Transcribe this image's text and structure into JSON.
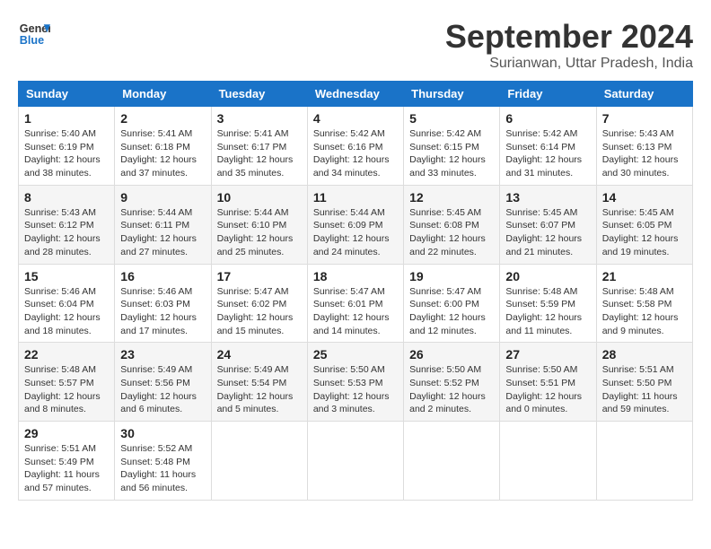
{
  "header": {
    "logo_line1": "General",
    "logo_line2": "Blue",
    "month": "September 2024",
    "location": "Surianwan, Uttar Pradesh, India"
  },
  "weekdays": [
    "Sunday",
    "Monday",
    "Tuesday",
    "Wednesday",
    "Thursday",
    "Friday",
    "Saturday"
  ],
  "weeks": [
    [
      {
        "day": "1",
        "info": "Sunrise: 5:40 AM\nSunset: 6:19 PM\nDaylight: 12 hours\nand 38 minutes."
      },
      {
        "day": "2",
        "info": "Sunrise: 5:41 AM\nSunset: 6:18 PM\nDaylight: 12 hours\nand 37 minutes."
      },
      {
        "day": "3",
        "info": "Sunrise: 5:41 AM\nSunset: 6:17 PM\nDaylight: 12 hours\nand 35 minutes."
      },
      {
        "day": "4",
        "info": "Sunrise: 5:42 AM\nSunset: 6:16 PM\nDaylight: 12 hours\nand 34 minutes."
      },
      {
        "day": "5",
        "info": "Sunrise: 5:42 AM\nSunset: 6:15 PM\nDaylight: 12 hours\nand 33 minutes."
      },
      {
        "day": "6",
        "info": "Sunrise: 5:42 AM\nSunset: 6:14 PM\nDaylight: 12 hours\nand 31 minutes."
      },
      {
        "day": "7",
        "info": "Sunrise: 5:43 AM\nSunset: 6:13 PM\nDaylight: 12 hours\nand 30 minutes."
      }
    ],
    [
      {
        "day": "8",
        "info": "Sunrise: 5:43 AM\nSunset: 6:12 PM\nDaylight: 12 hours\nand 28 minutes."
      },
      {
        "day": "9",
        "info": "Sunrise: 5:44 AM\nSunset: 6:11 PM\nDaylight: 12 hours\nand 27 minutes."
      },
      {
        "day": "10",
        "info": "Sunrise: 5:44 AM\nSunset: 6:10 PM\nDaylight: 12 hours\nand 25 minutes."
      },
      {
        "day": "11",
        "info": "Sunrise: 5:44 AM\nSunset: 6:09 PM\nDaylight: 12 hours\nand 24 minutes."
      },
      {
        "day": "12",
        "info": "Sunrise: 5:45 AM\nSunset: 6:08 PM\nDaylight: 12 hours\nand 22 minutes."
      },
      {
        "day": "13",
        "info": "Sunrise: 5:45 AM\nSunset: 6:07 PM\nDaylight: 12 hours\nand 21 minutes."
      },
      {
        "day": "14",
        "info": "Sunrise: 5:45 AM\nSunset: 6:05 PM\nDaylight: 12 hours\nand 19 minutes."
      }
    ],
    [
      {
        "day": "15",
        "info": "Sunrise: 5:46 AM\nSunset: 6:04 PM\nDaylight: 12 hours\nand 18 minutes."
      },
      {
        "day": "16",
        "info": "Sunrise: 5:46 AM\nSunset: 6:03 PM\nDaylight: 12 hours\nand 17 minutes."
      },
      {
        "day": "17",
        "info": "Sunrise: 5:47 AM\nSunset: 6:02 PM\nDaylight: 12 hours\nand 15 minutes."
      },
      {
        "day": "18",
        "info": "Sunrise: 5:47 AM\nSunset: 6:01 PM\nDaylight: 12 hours\nand 14 minutes."
      },
      {
        "day": "19",
        "info": "Sunrise: 5:47 AM\nSunset: 6:00 PM\nDaylight: 12 hours\nand 12 minutes."
      },
      {
        "day": "20",
        "info": "Sunrise: 5:48 AM\nSunset: 5:59 PM\nDaylight: 12 hours\nand 11 minutes."
      },
      {
        "day": "21",
        "info": "Sunrise: 5:48 AM\nSunset: 5:58 PM\nDaylight: 12 hours\nand 9 minutes."
      }
    ],
    [
      {
        "day": "22",
        "info": "Sunrise: 5:48 AM\nSunset: 5:57 PM\nDaylight: 12 hours\nand 8 minutes."
      },
      {
        "day": "23",
        "info": "Sunrise: 5:49 AM\nSunset: 5:56 PM\nDaylight: 12 hours\nand 6 minutes."
      },
      {
        "day": "24",
        "info": "Sunrise: 5:49 AM\nSunset: 5:54 PM\nDaylight: 12 hours\nand 5 minutes."
      },
      {
        "day": "25",
        "info": "Sunrise: 5:50 AM\nSunset: 5:53 PM\nDaylight: 12 hours\nand 3 minutes."
      },
      {
        "day": "26",
        "info": "Sunrise: 5:50 AM\nSunset: 5:52 PM\nDaylight: 12 hours\nand 2 minutes."
      },
      {
        "day": "27",
        "info": "Sunrise: 5:50 AM\nSunset: 5:51 PM\nDaylight: 12 hours\nand 0 minutes."
      },
      {
        "day": "28",
        "info": "Sunrise: 5:51 AM\nSunset: 5:50 PM\nDaylight: 11 hours\nand 59 minutes."
      }
    ],
    [
      {
        "day": "29",
        "info": "Sunrise: 5:51 AM\nSunset: 5:49 PM\nDaylight: 11 hours\nand 57 minutes."
      },
      {
        "day": "30",
        "info": "Sunrise: 5:52 AM\nSunset: 5:48 PM\nDaylight: 11 hours\nand 56 minutes."
      },
      null,
      null,
      null,
      null,
      null
    ]
  ]
}
